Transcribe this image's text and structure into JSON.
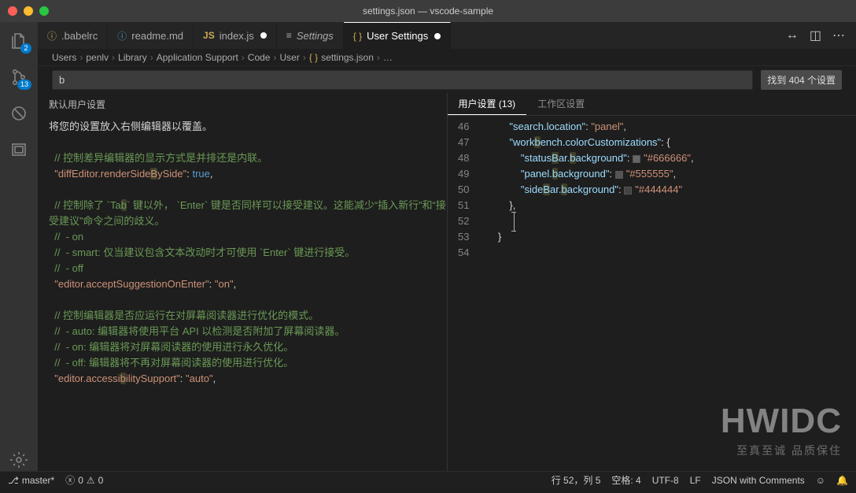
{
  "window": {
    "title": "settings.json — vscode-sample"
  },
  "tabs": [
    {
      "label": ".babelrc",
      "icon_color": "#cdab53",
      "italic": false,
      "active": false,
      "dirty": false
    },
    {
      "label": "readme.md",
      "icon_color": "#519aba",
      "italic": false,
      "active": false,
      "dirty": false
    },
    {
      "label": "index.js",
      "icon_badge": "JS",
      "icon_color": "#cdab53",
      "italic": false,
      "active": false,
      "dirty": true
    },
    {
      "label": "Settings",
      "icon": "sliders",
      "italic": true,
      "active": false,
      "dirty": false
    },
    {
      "label": "User Settings",
      "icon": "{}",
      "icon_color": "#cdab53",
      "italic": false,
      "active": true,
      "dirty": true
    }
  ],
  "activity_bar": {
    "items": [
      {
        "name": "explorer-icon",
        "badge": "2"
      },
      {
        "name": "source-control-icon",
        "badge": "13"
      },
      {
        "name": "bug-disabled-icon",
        "badge": null
      },
      {
        "name": "window-icon",
        "badge": null
      }
    ],
    "bottom": [
      {
        "name": "settings-gear-icon",
        "badge": null
      }
    ]
  },
  "breadcrumbs": [
    "Users",
    "penlv",
    "Library",
    "Application Support",
    "Code",
    "User",
    "settings.json",
    "…"
  ],
  "search": {
    "value": "b",
    "result_text": "找到 404 个设置"
  },
  "left_pane": {
    "header": "默认用户设置",
    "lines": [
      {
        "t": "plain",
        "text": "将您的设置放入右侧编辑器以覆盖。"
      },
      {
        "t": "blank"
      },
      {
        "t": "comment",
        "text": "  // 控制差异编辑器的显示方式是并排还是内联。"
      },
      {
        "t": "setting",
        "key": "diffEditor.renderSideBySide",
        "value_type": "bool",
        "value": "true"
      },
      {
        "t": "blank"
      },
      {
        "t": "comment",
        "text": "  // 控制除了 `Tab` 键以外， `Enter` 键是否同样可以接受建议。这能减少“插入新行”和“接受建议”命令之间的歧义。"
      },
      {
        "t": "comment",
        "text": "  //  - on"
      },
      {
        "t": "comment",
        "text": "  //  - smart: 仅当建议包含文本改动时才可使用 `Enter` 键进行接受。"
      },
      {
        "t": "comment",
        "text": "  //  - off"
      },
      {
        "t": "setting",
        "key": "editor.acceptSuggestionOnEnter",
        "value_type": "str",
        "value": "on"
      },
      {
        "t": "blank"
      },
      {
        "t": "comment",
        "text": "  // 控制编辑器是否应运行在对屏幕阅读器进行优化的模式。"
      },
      {
        "t": "comment",
        "text": "  //  - auto: 编辑器将使用平台 API 以检测是否附加了屏幕阅读器。"
      },
      {
        "t": "comment",
        "text": "  //  - on: 编辑器将对屏幕阅读器的使用进行永久优化。"
      },
      {
        "t": "comment",
        "text": "  //  - off: 编辑器将不再对屏幕阅读器的使用进行优化。"
      },
      {
        "t": "setting",
        "key": "editor.accessibilitySupport",
        "value_type": "str",
        "value": "auto"
      }
    ]
  },
  "right_pane": {
    "tabs": [
      {
        "label": "用户设置 (13)",
        "active": true
      },
      {
        "label": "工作区设置",
        "active": false
      }
    ],
    "gutter_start": 46,
    "lines": [
      {
        "indent": 2,
        "frag": [
          {
            "k": "prop",
            "v": "\"search.location\""
          },
          {
            "k": "br",
            "v": ": "
          },
          {
            "k": "str",
            "v": "\"panel\""
          },
          {
            "k": "br",
            "v": ","
          }
        ]
      },
      {
        "indent": 2,
        "frag": [
          {
            "k": "prop",
            "v": "\"workbench.colorCustomizations\""
          },
          {
            "k": "br",
            "v": ": {"
          }
        ]
      },
      {
        "indent": 3,
        "frag": [
          {
            "k": "prop",
            "v": "\"statusBar.background\""
          },
          {
            "k": "br",
            "v": ": "
          },
          {
            "k": "swatch",
            "v": "#666666"
          },
          {
            "k": "str",
            "v": "\"#666666\""
          },
          {
            "k": "br",
            "v": ","
          }
        ]
      },
      {
        "indent": 3,
        "frag": [
          {
            "k": "prop",
            "v": "\"panel.background\""
          },
          {
            "k": "br",
            "v": ": "
          },
          {
            "k": "swatch",
            "v": "#555555"
          },
          {
            "k": "str",
            "v": "\"#555555\""
          },
          {
            "k": "br",
            "v": ","
          }
        ]
      },
      {
        "indent": 3,
        "frag": [
          {
            "k": "prop",
            "v": "\"sideBar.background\""
          },
          {
            "k": "br",
            "v": ": "
          },
          {
            "k": "swatch",
            "v": "#444444"
          },
          {
            "k": "str",
            "v": "\"#444444\""
          }
        ]
      },
      {
        "indent": 2,
        "frag": [
          {
            "k": "br",
            "v": "},"
          }
        ]
      },
      {
        "indent": 2,
        "frag": [],
        "cursor": true
      },
      {
        "indent": 1,
        "frag": [
          {
            "k": "br",
            "v": "}"
          }
        ]
      },
      {
        "indent": 0,
        "frag": []
      }
    ]
  },
  "statusbar": {
    "branch_icon": "⎇",
    "branch": "master*",
    "errors": "0",
    "warnings": "0",
    "line_col": "行 52，列 5",
    "spaces": "空格: 4",
    "encoding": "UTF-8",
    "eol": "LF",
    "language": "JSON with Comments"
  },
  "watermark": {
    "big": "HWIDC",
    "small": "至真至诚 品质保住"
  },
  "highlight_char": "b"
}
